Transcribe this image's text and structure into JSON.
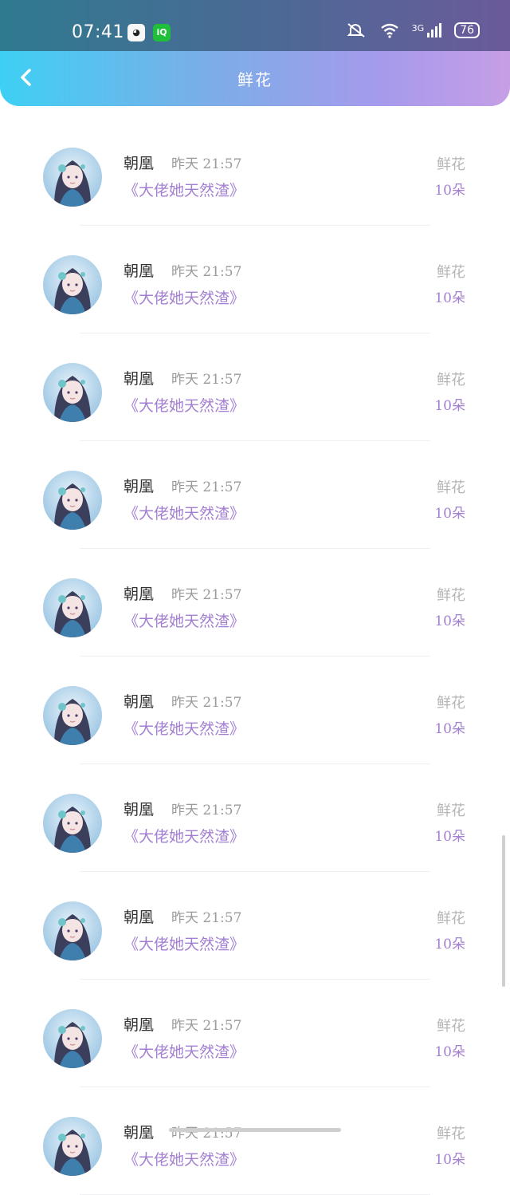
{
  "status_bar": {
    "time": "07:41",
    "icons": [
      "qq-icon",
      "iqiyi-icon",
      "mute-icon",
      "wifi-icon",
      "signal-3g-icon",
      "battery-icon"
    ],
    "network": "3G",
    "battery": "76"
  },
  "header": {
    "title": "鲜花",
    "back_icon": "chevron-left-icon"
  },
  "records": [
    {
      "user": "朝凰",
      "time": "昨天 21:57",
      "book": "《大佬她天然渣》",
      "gift": "鲜花",
      "count": "10朵"
    },
    {
      "user": "朝凰",
      "time": "昨天 21:57",
      "book": "《大佬她天然渣》",
      "gift": "鲜花",
      "count": "10朵"
    },
    {
      "user": "朝凰",
      "time": "昨天 21:57",
      "book": "《大佬她天然渣》",
      "gift": "鲜花",
      "count": "10朵"
    },
    {
      "user": "朝凰",
      "time": "昨天 21:57",
      "book": "《大佬她天然渣》",
      "gift": "鲜花",
      "count": "10朵"
    },
    {
      "user": "朝凰",
      "time": "昨天 21:57",
      "book": "《大佬她天然渣》",
      "gift": "鲜花",
      "count": "10朵"
    },
    {
      "user": "朝凰",
      "time": "昨天 21:57",
      "book": "《大佬她天然渣》",
      "gift": "鲜花",
      "count": "10朵"
    },
    {
      "user": "朝凰",
      "time": "昨天 21:57",
      "book": "《大佬她天然渣》",
      "gift": "鲜花",
      "count": "10朵"
    },
    {
      "user": "朝凰",
      "time": "昨天 21:57",
      "book": "《大佬她天然渣》",
      "gift": "鲜花",
      "count": "10朵"
    },
    {
      "user": "朝凰",
      "time": "昨天 21:57",
      "book": "《大佬她天然渣》",
      "gift": "鲜花",
      "count": "10朵"
    },
    {
      "user": "朝凰",
      "time": "昨天 21:57",
      "book": "《大佬她天然渣》",
      "gift": "鲜花",
      "count": "10朵"
    }
  ],
  "colors": {
    "accent_purple": "#a37fd2",
    "header_gradient_start": "#3ed0f4",
    "header_gradient_end": "#c69ee6"
  }
}
